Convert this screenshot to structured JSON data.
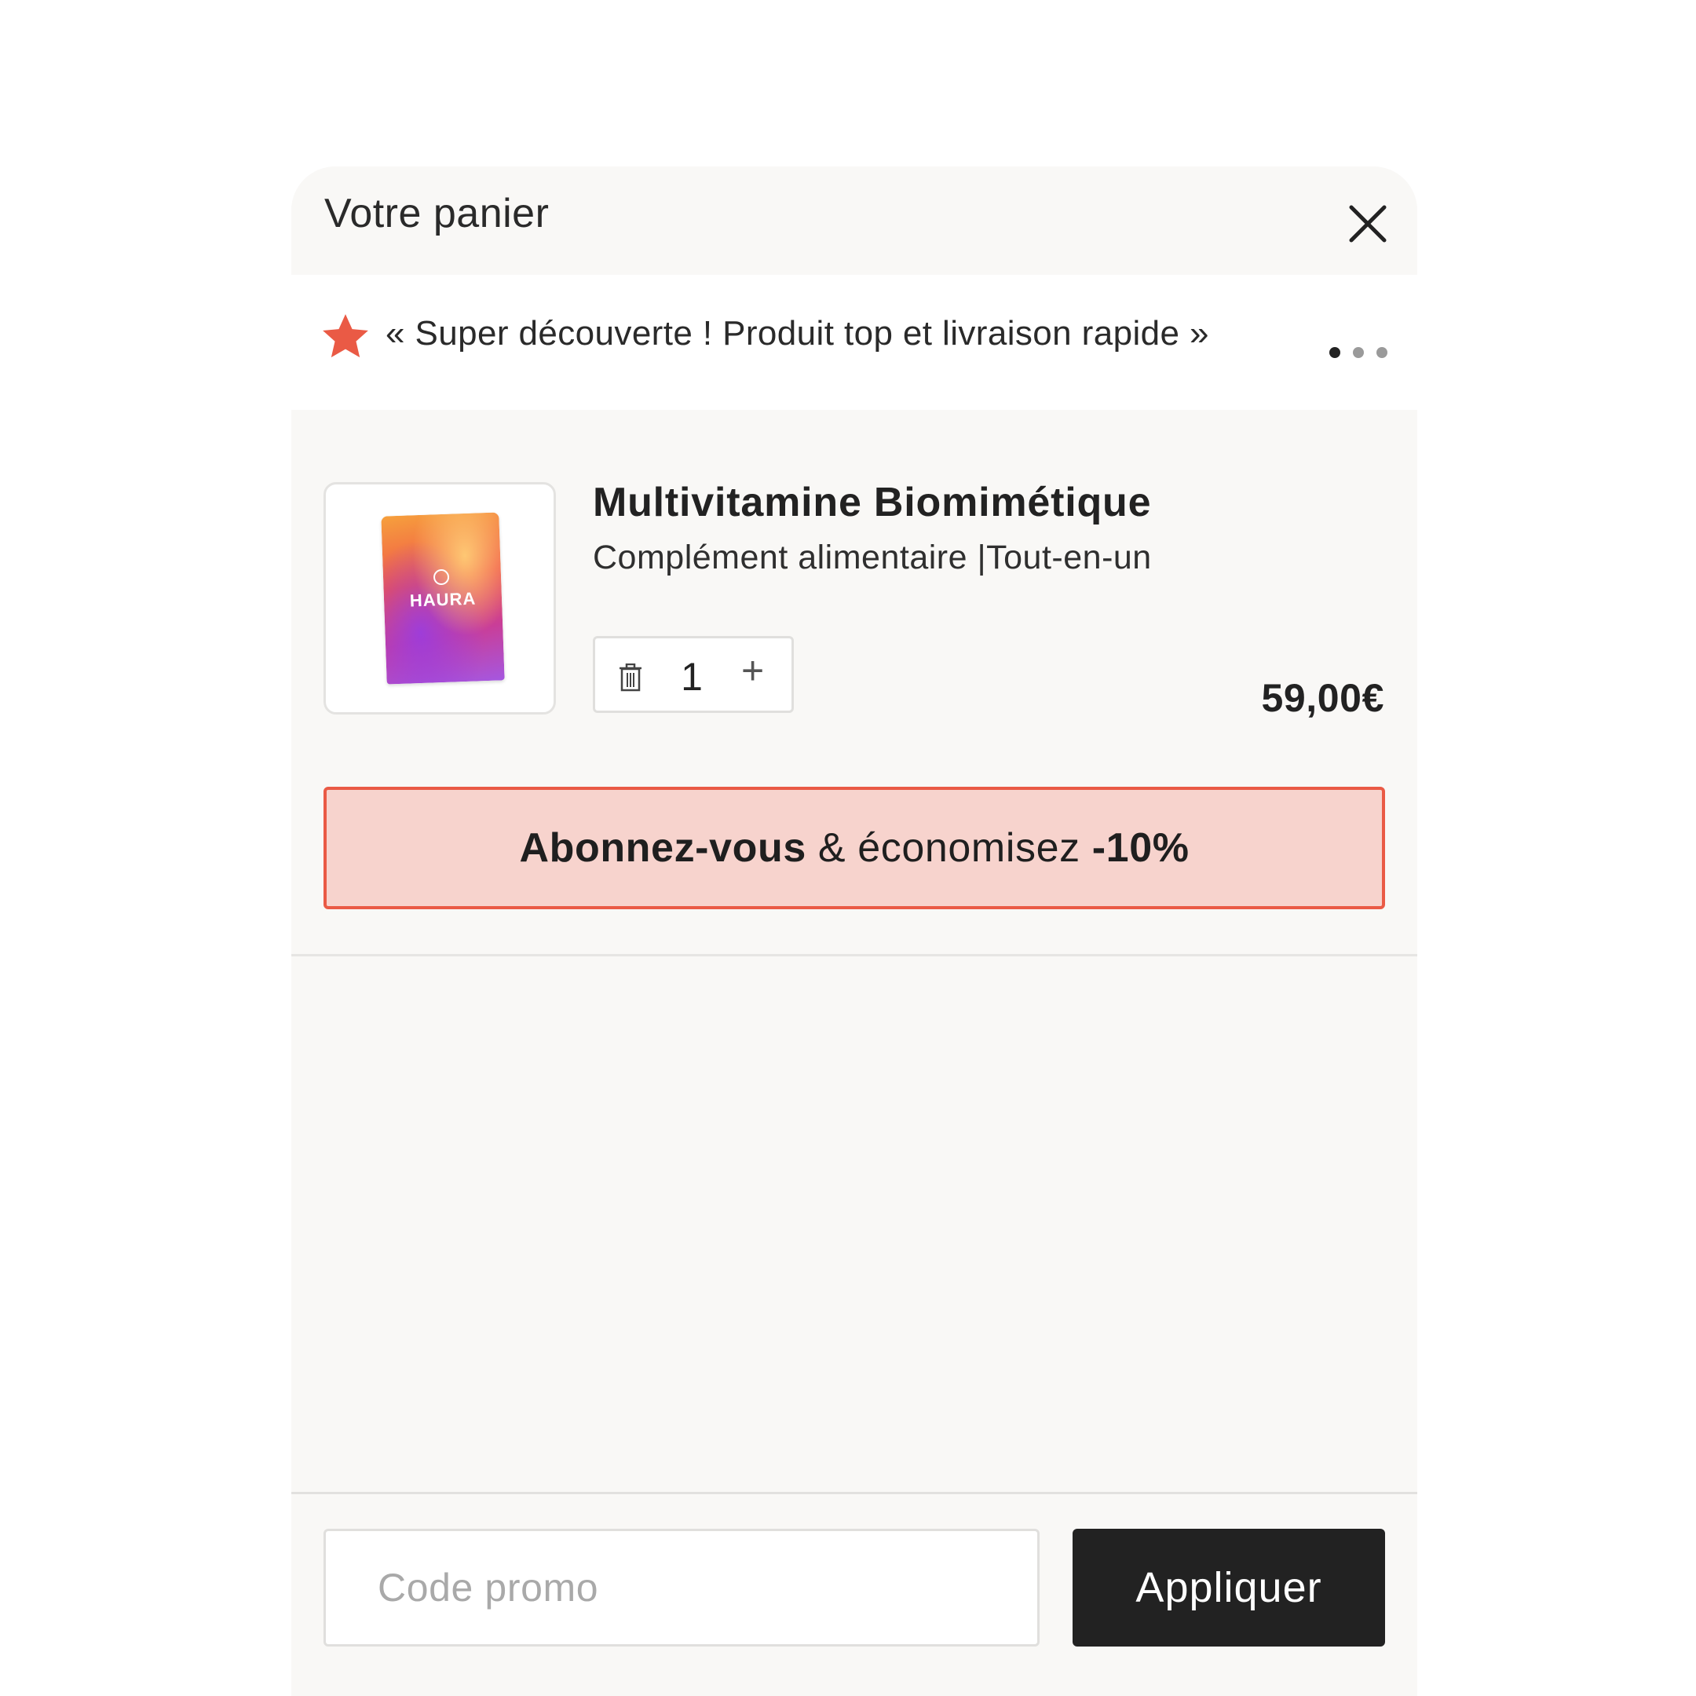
{
  "cart": {
    "title": "Votre panier",
    "close_icon": "close-icon"
  },
  "review_banner": {
    "icon": "star-icon",
    "star_color": "#ea5a45",
    "text": "« Super découverte ! Produit top et livraison rapide »",
    "carousel_dots": 3,
    "active_dot": 1
  },
  "product": {
    "image_brand": "HAURA",
    "name": "Multivitamine Biomimétique",
    "subtitle": "Complément alimentaire |Tout-en-un",
    "quantity": "1",
    "price": "59,00€"
  },
  "subscribe": {
    "bold_1": "Abonnez-vous",
    "middle": " & économisez ",
    "bold_2": "-10%",
    "background_color": "#f7d3cd",
    "border_color": "#ea5a45"
  },
  "promo": {
    "placeholder": "Code promo",
    "apply_label": "Appliquer"
  }
}
